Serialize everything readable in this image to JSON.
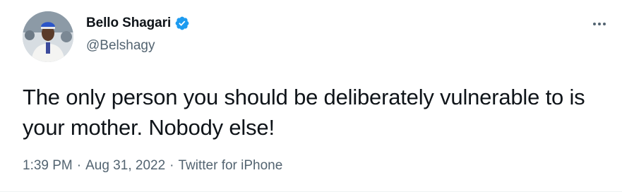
{
  "tweet": {
    "author": {
      "display_name": "Bello Shagari",
      "handle": "@Belshagy",
      "verified": true,
      "verified_icon": "verified-badge-icon",
      "avatar_icon": "profile-photo"
    },
    "more_icon": "more-options-icon",
    "text": "The only person you should be deliberately vulnerable to is your mother. Nobody else!",
    "time": "1:39 PM",
    "date": "Aug 31, 2022",
    "separator": "·",
    "source": "Twitter for iPhone"
  },
  "colors": {
    "text_primary": "#0f1419",
    "text_secondary": "#536471",
    "verified_blue": "#1d9bf0",
    "background": "#ffffff"
  }
}
